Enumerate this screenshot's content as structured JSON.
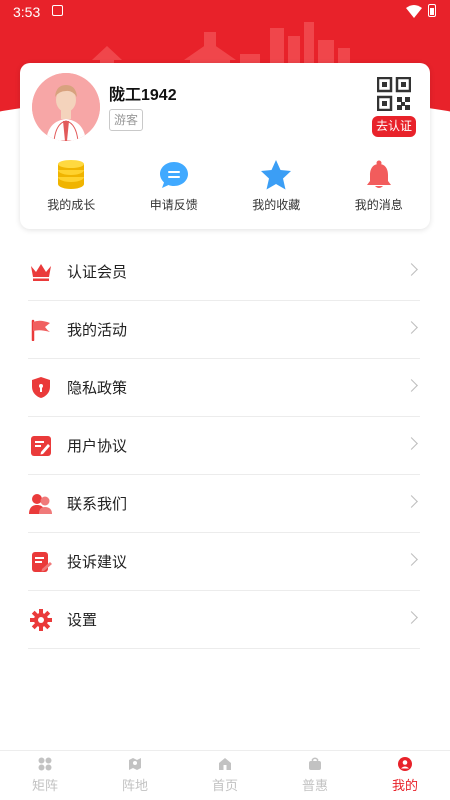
{
  "status_bar": {
    "time": "3:53"
  },
  "profile": {
    "username": "陇工1942",
    "role_badge": "游客",
    "verify_label": "去认证"
  },
  "quick_actions": [
    {
      "label": "我的成长",
      "icon": "coins-stack-icon"
    },
    {
      "label": "申请反馈",
      "icon": "chat-bubble-icon"
    },
    {
      "label": "我的收藏",
      "icon": "star-icon"
    },
    {
      "label": "我的消息",
      "icon": "bell-icon"
    }
  ],
  "menu": [
    {
      "label": "认证会员",
      "icon": "crown-icon"
    },
    {
      "label": "我的活动",
      "icon": "flag-icon"
    },
    {
      "label": "隐私政策",
      "icon": "shield-icon"
    },
    {
      "label": "用户协议",
      "icon": "document-edit-icon"
    },
    {
      "label": "联系我们",
      "icon": "contacts-icon"
    },
    {
      "label": "投诉建议",
      "icon": "note-edit-icon"
    },
    {
      "label": "设置",
      "icon": "gear-icon"
    }
  ],
  "bottom_nav": [
    {
      "label": "矩阵",
      "icon": "grid-icon"
    },
    {
      "label": "阵地",
      "icon": "map-icon"
    },
    {
      "label": "首页",
      "icon": "home-icon"
    },
    {
      "label": "普惠",
      "icon": "bag-icon"
    },
    {
      "label": "我的",
      "icon": "user-icon",
      "active": true
    }
  ],
  "colors": {
    "accent": "#e8222a",
    "muted": "#c2c2c2"
  }
}
